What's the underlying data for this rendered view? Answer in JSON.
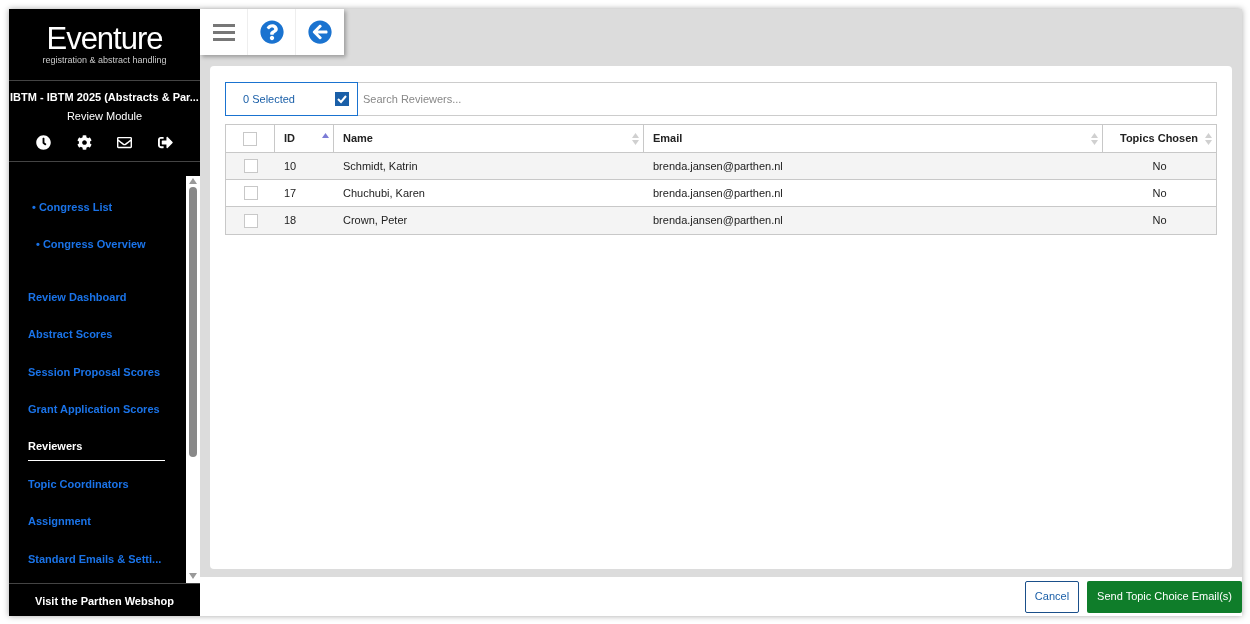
{
  "logo": {
    "name": "Eventure",
    "tagline": "registration & abstract handling"
  },
  "congress": {
    "title": "IBTM - IBTM 2025 (Abstracts & Par...",
    "module": "Review Module"
  },
  "nav": [
    {
      "label": "• Congress List",
      "kind": "sub",
      "selected": false
    },
    {
      "label": "• Congress Overview",
      "kind": "sub2",
      "selected": false
    },
    {
      "label": "Review Dashboard",
      "kind": "main",
      "selected": false
    },
    {
      "label": "Abstract Scores",
      "kind": "main",
      "selected": false
    },
    {
      "label": "Session Proposal Scores",
      "kind": "main",
      "selected": false
    },
    {
      "label": "Grant Application Scores",
      "kind": "main",
      "selected": false
    },
    {
      "label": "Reviewers",
      "kind": "main",
      "selected": true
    },
    {
      "label": "Topic Coordinators",
      "kind": "main",
      "selected": false
    },
    {
      "label": "Assignment",
      "kind": "main",
      "selected": false
    },
    {
      "label": "Standard Emails & Setti...",
      "kind": "main",
      "selected": false
    }
  ],
  "footer_link": "Visit the Parthen Webshop",
  "selection": {
    "label": "0 Selected",
    "checked": true
  },
  "search": {
    "placeholder": "Search Reviewers..."
  },
  "table": {
    "select_all_checked": false,
    "columns": [
      {
        "label": "ID",
        "sorted": true
      },
      {
        "label": "Name",
        "sorted": false
      },
      {
        "label": "Email",
        "sorted": false
      },
      {
        "label": "Topics Chosen",
        "sorted": false
      }
    ],
    "rows": [
      {
        "checked": false,
        "cells": [
          "10",
          "Schmidt, Katrin",
          "brenda.jansen@parthen.nl",
          "No"
        ]
      },
      {
        "checked": false,
        "cells": [
          "17",
          "Chuchubi, Karen",
          "brenda.jansen@parthen.nl",
          "No"
        ]
      },
      {
        "checked": false,
        "cells": [
          "18",
          "Crown, Peter",
          "brenda.jansen@parthen.nl",
          "No"
        ]
      }
    ]
  },
  "buttons": {
    "cancel": "Cancel",
    "send": "Send Topic Choice Email(s)"
  }
}
